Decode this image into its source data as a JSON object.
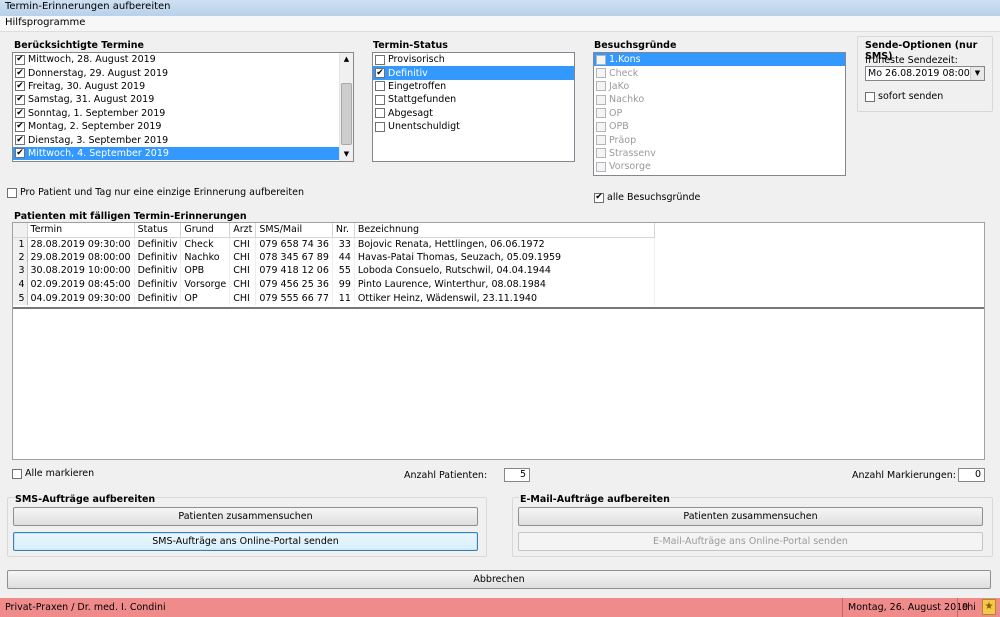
{
  "window": {
    "title": "Termin-Erinnerungen aufbereiten"
  },
  "menu": {
    "item": "Hilfsprogramme"
  },
  "termine": {
    "title": "Berücksichtigte Termine",
    "items": [
      {
        "label": "Mittwoch, 28. August 2019",
        "checked": true,
        "selected": false
      },
      {
        "label": "Donnerstag, 29. August 2019",
        "checked": true,
        "selected": false
      },
      {
        "label": "Freitag, 30. August 2019",
        "checked": true,
        "selected": false
      },
      {
        "label": "Samstag, 31. August 2019",
        "checked": true,
        "selected": false
      },
      {
        "label": "Sonntag, 1. September 2019",
        "checked": true,
        "selected": false
      },
      {
        "label": "Montag, 2. September 2019",
        "checked": true,
        "selected": false
      },
      {
        "label": "Dienstag, 3. September 2019",
        "checked": true,
        "selected": false
      },
      {
        "label": "Mittwoch, 4. September 2019",
        "checked": true,
        "selected": true
      }
    ]
  },
  "status": {
    "title": "Termin-Status",
    "items": [
      {
        "label": "Provisorisch",
        "checked": false,
        "selected": false
      },
      {
        "label": "Definitiv",
        "checked": true,
        "selected": true
      },
      {
        "label": "Eingetroffen",
        "checked": false,
        "selected": false
      },
      {
        "label": "Stattgefunden",
        "checked": false,
        "selected": false
      },
      {
        "label": "Abgesagt",
        "checked": false,
        "selected": false
      },
      {
        "label": "Unentschuldigt",
        "checked": false,
        "selected": false
      }
    ]
  },
  "gruende": {
    "title": "Besuchsgründe",
    "items": [
      {
        "label": "1.Kons",
        "checked": false,
        "selected": true
      },
      {
        "label": "Check",
        "checked": false,
        "selected": false
      },
      {
        "label": "JaKo",
        "checked": false,
        "selected": false
      },
      {
        "label": "Nachko",
        "checked": false,
        "selected": false
      },
      {
        "label": "OP",
        "checked": false,
        "selected": false
      },
      {
        "label": "OPB",
        "checked": false,
        "selected": false
      },
      {
        "label": "Präop",
        "checked": false,
        "selected": false
      },
      {
        "label": "Strassenv",
        "checked": false,
        "selected": false
      },
      {
        "label": "Vorsorge",
        "checked": false,
        "selected": false
      }
    ],
    "all_label": "alle Besuchsgründe"
  },
  "sms_options": {
    "title": "Sende-Optionen (nur SMS)",
    "earliest_label": "früheste Sendezeit:",
    "earliest_value": "Mo 26.08.2019 08:00",
    "immediate_label": "sofort senden"
  },
  "single_reminder_label": "Pro Patient und Tag nur eine einzige Erinnerung aufbereiten",
  "patients": {
    "title": "Patienten mit fälligen Termin-Erinnerungen",
    "columns": [
      "Termin",
      "Status",
      "Grund",
      "Arzt",
      "SMS/Mail",
      "Nr.",
      "Bezeichnung"
    ],
    "rows": [
      {
        "n": "1",
        "termin": "28.08.2019 09:30:00",
        "status": "Definitiv",
        "grund": "Check",
        "arzt": "CHI",
        "sms": "079 658 74 36",
        "nr": "33",
        "bez": "Bojovic Renata, Hettlingen, 06.06.1972"
      },
      {
        "n": "2",
        "termin": "29.08.2019 08:00:00",
        "status": "Definitiv",
        "grund": "Nachko",
        "arzt": "CHI",
        "sms": "078 345 67 89",
        "nr": "44",
        "bez": "Havas-Patai Thomas, Seuzach, 05.09.1959"
      },
      {
        "n": "3",
        "termin": "30.08.2019 10:00:00",
        "status": "Definitiv",
        "grund": "OPB",
        "arzt": "CHI",
        "sms": "079 418 12 06",
        "nr": "55",
        "bez": "Loboda Consuelo, Rutschwil, 04.04.1944"
      },
      {
        "n": "4",
        "termin": "02.09.2019 08:45:00",
        "status": "Definitiv",
        "grund": "Vorsorge",
        "arzt": "CHI",
        "sms": "079 456 25 36",
        "nr": "99",
        "bez": "Pinto Laurence, Winterthur, 08.08.1984"
      },
      {
        "n": "5",
        "termin": "04.09.2019 09:30:00",
        "status": "Definitiv",
        "grund": "OP",
        "arzt": "CHI",
        "sms": "079 555 66 77",
        "nr": "11",
        "bez": "Ottiker Heinz, Wädenswil, 23.11.1940"
      }
    ],
    "mark_all_label": "Alle markieren",
    "count_patients_label": "Anzahl Patienten:",
    "count_patients_value": "5",
    "count_marked_label": "Anzahl Markierungen:",
    "count_marked_value": "0"
  },
  "sms_jobs": {
    "title": "SMS-Aufträge aufbereiten",
    "collect_label": "Patienten zusammensuchen",
    "send_label": "SMS-Aufträge ans Online-Portal senden"
  },
  "email_jobs": {
    "title": "E-Mail-Aufträge aufbereiten",
    "collect_label": "Patienten zusammensuchen",
    "send_label": "E-Mail-Aufträge ans Online-Portal senden"
  },
  "cancel_label": "Abbrechen",
  "statusbar": {
    "practice": "Privat-Praxen / Dr. med. I. Condini",
    "date": "Montag, 26. August 2019",
    "user": "chi",
    "color": "#f08b8b"
  }
}
